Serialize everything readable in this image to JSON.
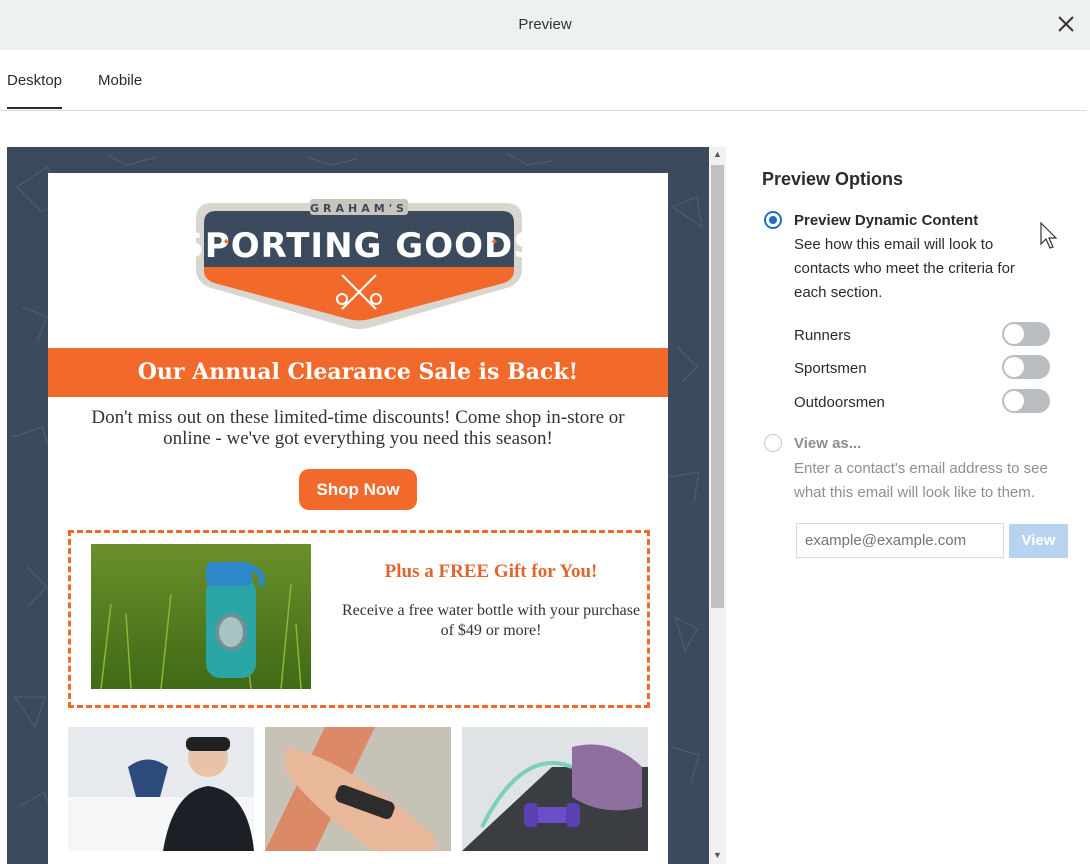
{
  "window": {
    "title": "Preview"
  },
  "tabs": [
    {
      "label": "Desktop",
      "active": true
    },
    {
      "label": "Mobile",
      "active": false
    }
  ],
  "email": {
    "logo": {
      "top_text": "GRAHAM'S",
      "main_text": "SPORTING GOODS"
    },
    "banner": "Our Annual Clearance Sale is Back!",
    "intro": "Don't miss out on these limited-time discounts! Come shop in-store or online - we've got everything you need this season!",
    "cta": "Shop Now",
    "gift": {
      "title": "Plus a FREE Gift for You!",
      "text": "Receive a free water bottle with your purchase of $49 or more!"
    },
    "photos": [
      "snowboarder-photo",
      "fitness-tracker-photo",
      "gym-equipment-photo"
    ]
  },
  "options": {
    "title": "Preview Options",
    "dynamic": {
      "label": "Preview Dynamic Content",
      "selected": true,
      "description": "See how this email will look to contacts who meet the criteria for each section.",
      "segments": [
        {
          "label": "Runners",
          "on": false
        },
        {
          "label": "Sportsmen",
          "on": false
        },
        {
          "label": "Outdoorsmen",
          "on": false
        }
      ]
    },
    "view_as": {
      "label": "View as...",
      "selected": false,
      "description": "Enter a contact's email address to see what this email will look like to them.",
      "placeholder": "example@example.com",
      "button": "View"
    }
  },
  "colors": {
    "accent": "#f26a2b",
    "radio": "#1f6dc9",
    "frame": "#3b4a5c"
  }
}
